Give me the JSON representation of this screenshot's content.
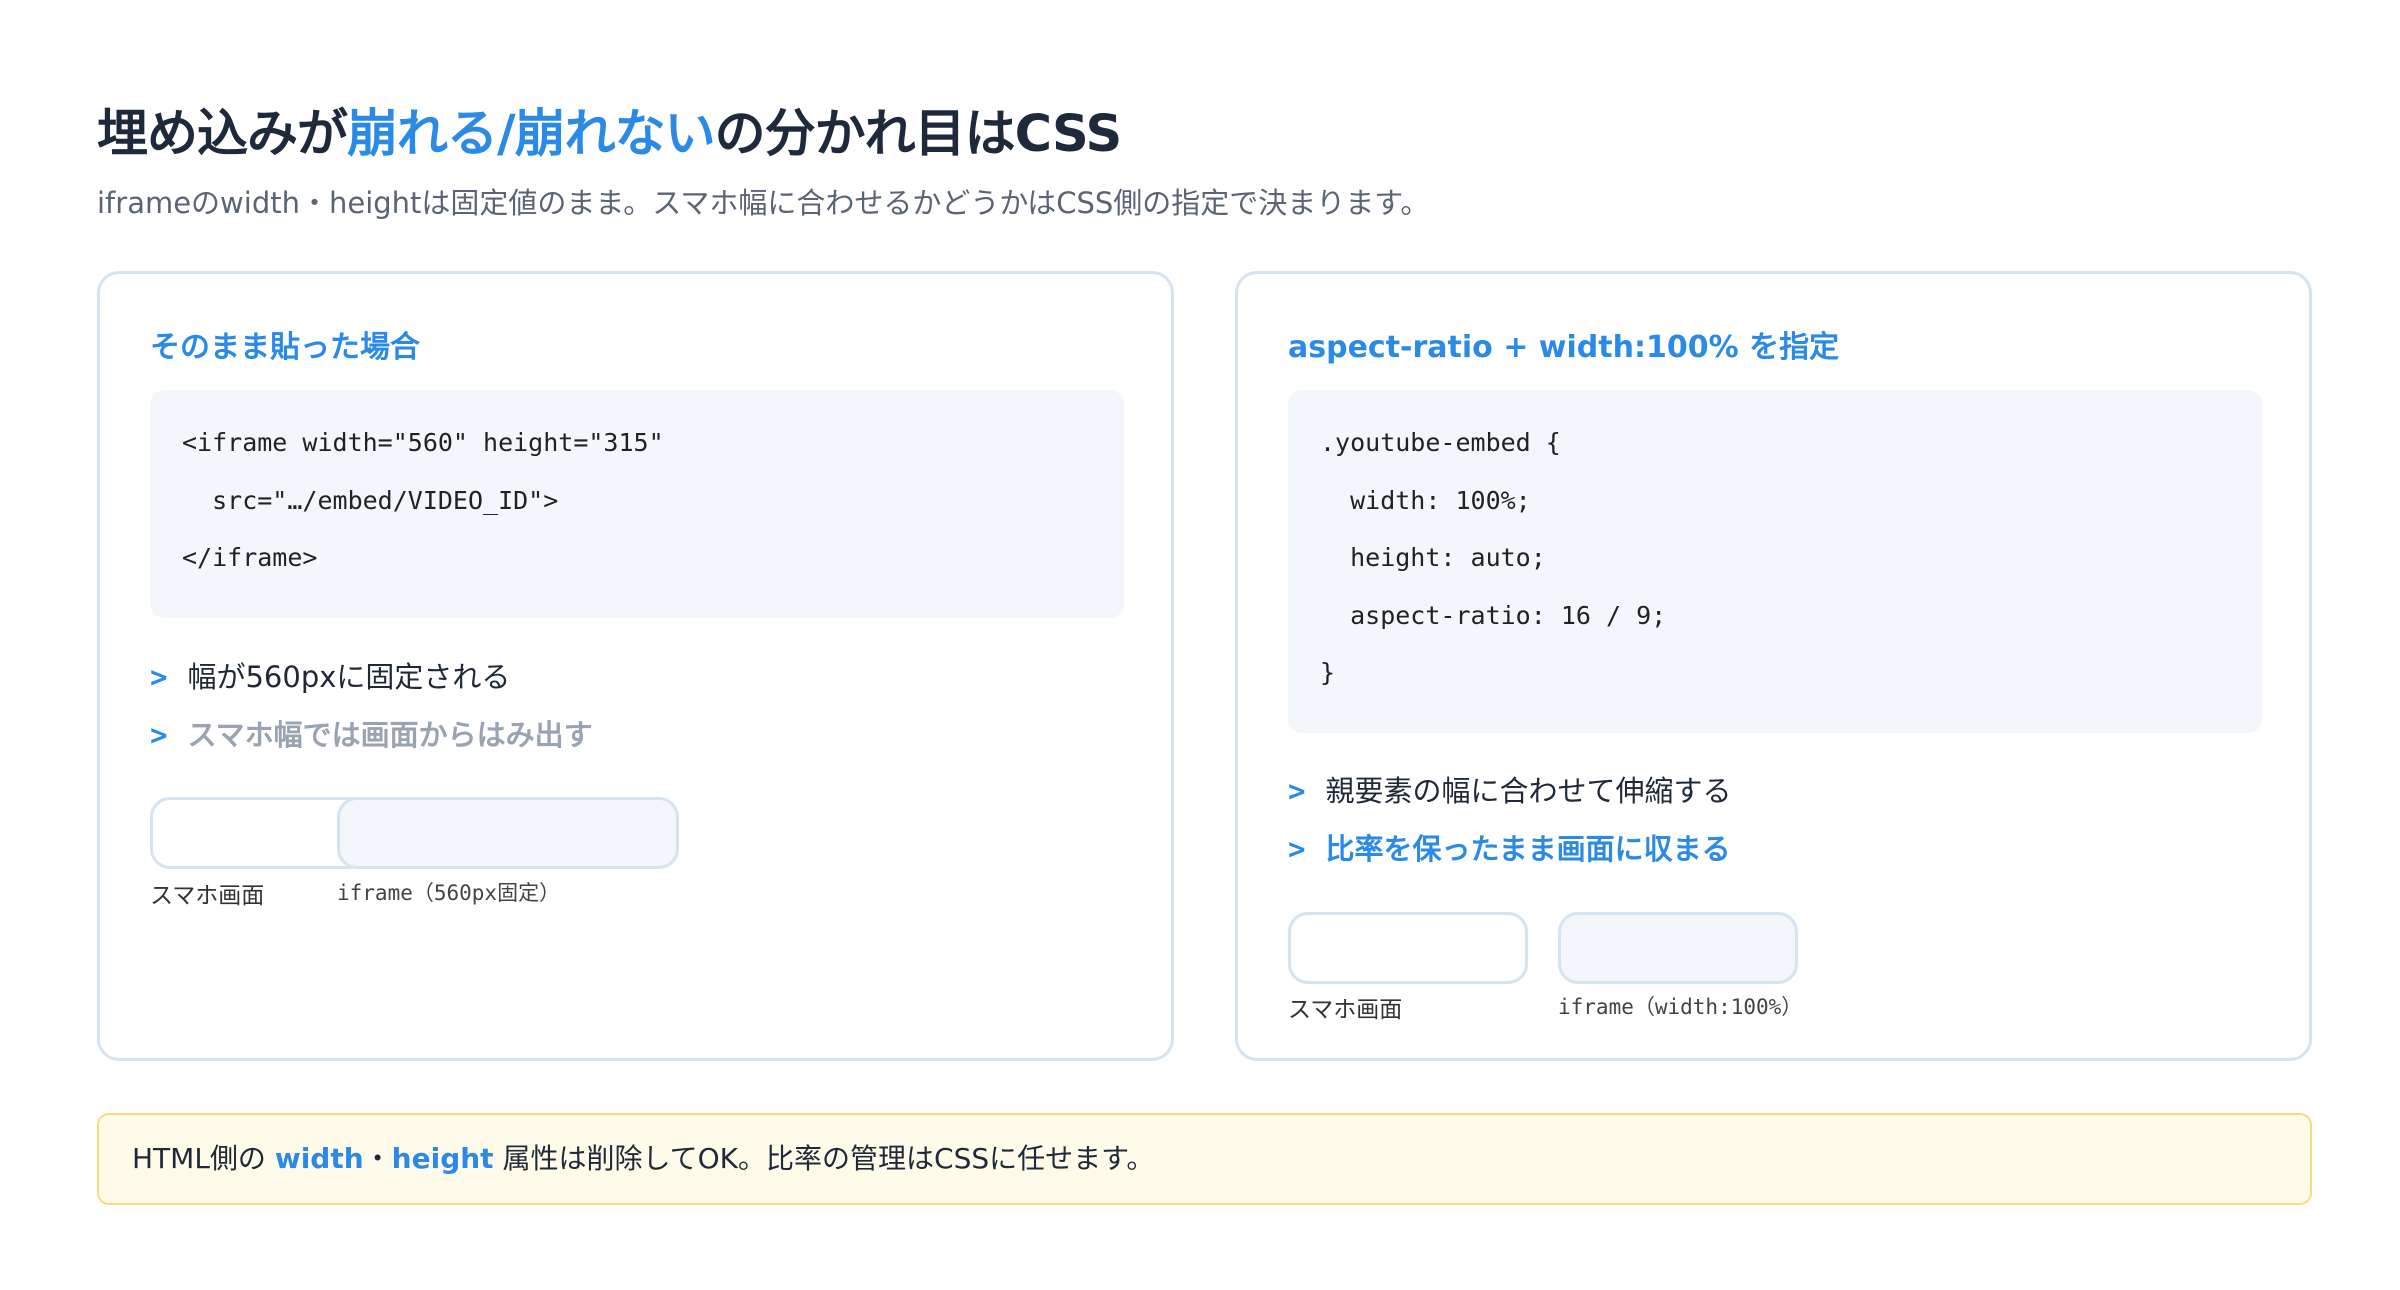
{
  "title": {
    "part1": "埋め込みが",
    "accent": "崩れる/崩れない",
    "part2": "の分かれ目はCSS"
  },
  "subtitle": "iframeのwidth・heightは固定値のまま。スマホ幅に合わせるかどうかはCSS側の指定で決まります。",
  "left_card": {
    "heading": "そのまま貼った場合",
    "code": [
      "<iframe width=\"560\" height=\"315\"",
      "  src=\"…/embed/VIDEO_ID\">",
      "</iframe>"
    ],
    "bullet_marker": ">",
    "bullets": [
      "幅が560pxに固定される",
      "スマホ幅では画面からはみ出す"
    ],
    "phone_caption": "スマホ画面",
    "iframe_caption": "iframe（560px固定）"
  },
  "right_card": {
    "heading": "aspect-ratio + width:100% を指定",
    "code": [
      ".youtube-embed {",
      "  width: 100%;",
      "  height: auto;",
      "  aspect-ratio: 16 / 9;",
      "}"
    ],
    "bullet_marker": ">",
    "bullets": [
      "親要素の幅に合わせて伸縮する",
      "比率を保ったまま画面に収まる"
    ],
    "phone_caption": "スマホ画面",
    "iframe_caption": "iframe（width:100%）"
  },
  "note": {
    "prefix": "HTML側の ",
    "kw1": "width",
    "sep": "・",
    "kw2": "height",
    "suffix": " 属性は削除してOK。比率の管理はCSSに任せます。"
  },
  "colors": {
    "accent": "#2b8ae6",
    "card_border": "#d6e4f2",
    "code_bg": "#f3f6fb",
    "note_bg": "#fffbea",
    "note_border": "#f6dc7a"
  }
}
